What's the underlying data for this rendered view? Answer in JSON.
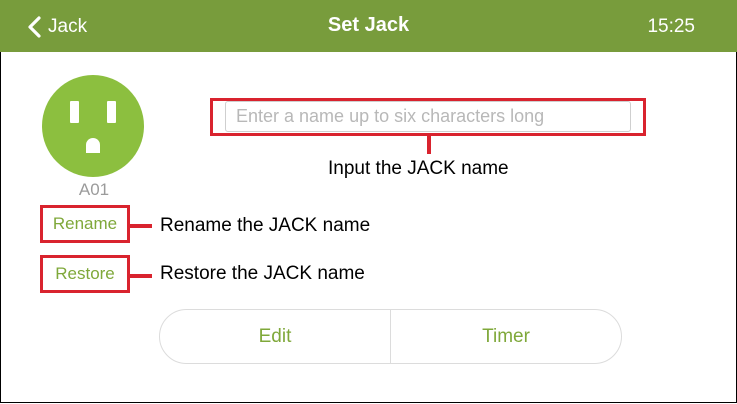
{
  "header": {
    "back_label": "Jack",
    "title": "Set Jack",
    "time": "15:25",
    "background": "#789c3c"
  },
  "device": {
    "icon": "outlet-icon",
    "id": "A01",
    "accent": "#8cbf3f"
  },
  "name_input": {
    "placeholder": "Enter a name up to six characters long",
    "value": ""
  },
  "actions": {
    "rename_label": "Rename",
    "restore_label": "Restore"
  },
  "annotations": {
    "input": "Input the JACK name",
    "rename": "Rename the JACK name",
    "restore": "Restore  the JACK name",
    "color": "#d9232e"
  },
  "segment": {
    "edit_label": "Edit",
    "timer_label": "Timer"
  }
}
